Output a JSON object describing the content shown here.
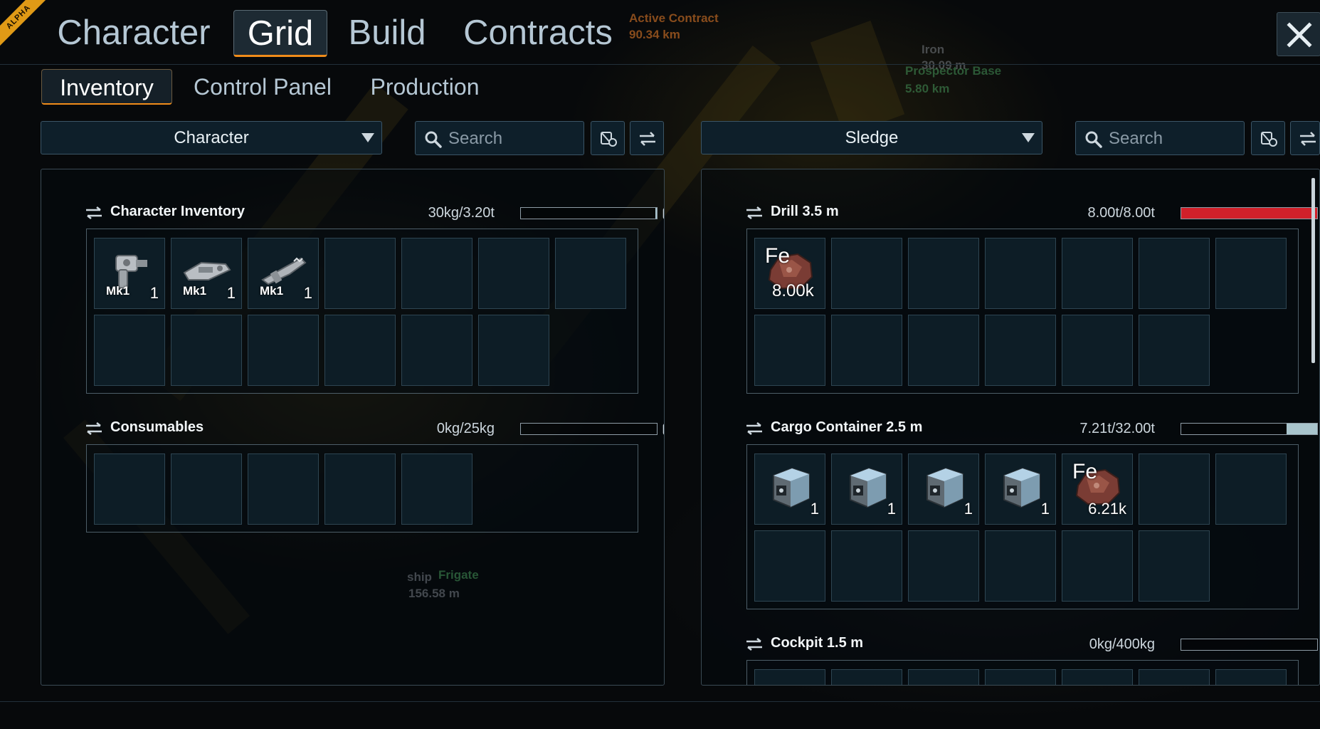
{
  "badge": "ALPHA",
  "hud": {
    "contract_label": "Active Contract",
    "contract_dist": "90.34 km",
    "iron_label": "Iron",
    "iron_dist": "30.09 m",
    "base_label": "Prospector Base",
    "base_dist": "5.80 km",
    "ship_label": "ship",
    "ship_name": "Frigate",
    "ship_dist": "156.58 m"
  },
  "main_tabs": [
    "Character",
    "Grid",
    "Build",
    "Contracts"
  ],
  "active_main_tab": "Grid",
  "sub_tabs": [
    "Inventory",
    "Control Panel",
    "Production"
  ],
  "active_sub_tab": "Inventory",
  "left": {
    "dropdown": "Character",
    "search_placeholder": "Search",
    "sections": [
      {
        "title": "Character Inventory",
        "capacity": "30kg/3.20t",
        "fill_fraction": 0.01,
        "slots": 13,
        "items": [
          {
            "icon": "hand-drill-icon",
            "tier": "Mk1",
            "qty": "1"
          },
          {
            "icon": "welder-icon",
            "tier": "Mk1",
            "qty": "1"
          },
          {
            "icon": "grinder-icon",
            "tier": "Mk1",
            "qty": "1"
          }
        ]
      },
      {
        "title": "Consumables",
        "capacity": "0kg/25kg",
        "fill_fraction": 0,
        "slots": 5,
        "items": []
      }
    ]
  },
  "right": {
    "dropdown": "Sledge",
    "search_placeholder": "Search",
    "sections": [
      {
        "title": "Drill 3.5 m",
        "capacity": "8.00t/8.00t",
        "fill_fraction": 1.0,
        "fill_color": "#d0202a",
        "slots": 13,
        "items": [
          {
            "icon": "iron-ore-icon",
            "symbol": "Fe",
            "qty": "8.00k"
          }
        ]
      },
      {
        "title": "Cargo Container 2.5 m",
        "capacity": "7.21t/32.00t",
        "fill_fraction": 0.2253,
        "fill_color": "#a8c4cc",
        "slots": 13,
        "items": [
          {
            "icon": "cargo-block-icon",
            "qty": "1"
          },
          {
            "icon": "cargo-block-icon",
            "qty": "1"
          },
          {
            "icon": "cargo-block-icon",
            "qty": "1"
          },
          {
            "icon": "cargo-block-icon",
            "qty": "1"
          },
          {
            "icon": "iron-ore-icon",
            "symbol": "Fe",
            "qty": "6.21k"
          }
        ]
      },
      {
        "title": "Cockpit 1.5 m",
        "capacity": "0kg/400kg",
        "fill_fraction": 0,
        "slots": 7,
        "items": []
      }
    ]
  },
  "colors": {
    "accent": "#f08c1a",
    "panel_bg": "#0e1f2a",
    "slot_bg": "#0d1d26",
    "full_bar": "#d0202a",
    "partial_bar": "#a8c4cc"
  }
}
